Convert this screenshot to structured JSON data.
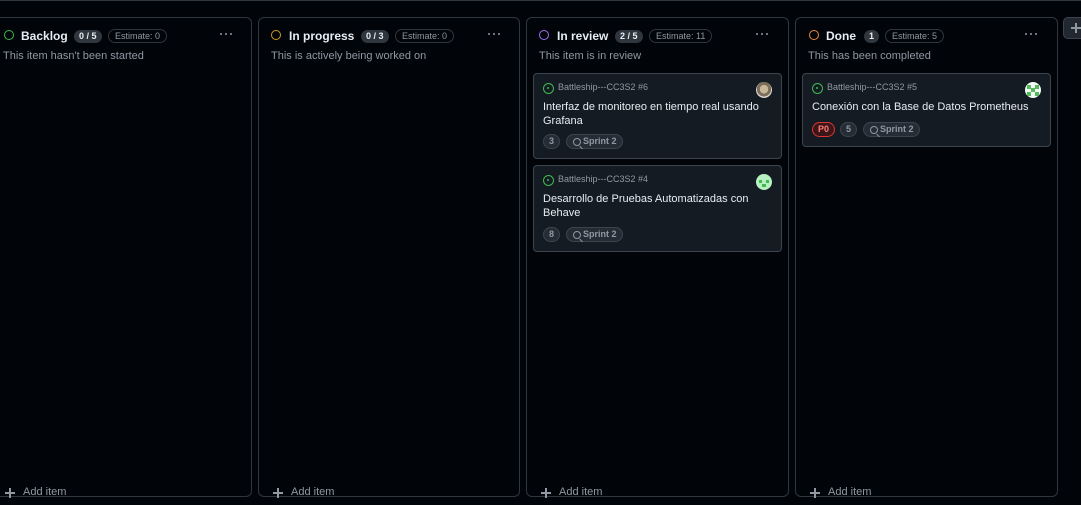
{
  "board": {
    "columns": [
      {
        "name": "Backlog",
        "count": "0 / 5",
        "estimate": "Estimate: 0",
        "description": "This item hasn't been started",
        "add_label": "Add item",
        "color": "#3fb950"
      },
      {
        "name": "In progress",
        "count": "0 / 3",
        "estimate": "Estimate: 0",
        "description": "This is actively being worked on",
        "add_label": "Add item",
        "color": "#d29922"
      },
      {
        "name": "In review",
        "count": "2 / 5",
        "estimate": "Estimate: 11",
        "description": "This item is in review",
        "add_label": "Add item",
        "color": "#a371f7"
      },
      {
        "name": "Done",
        "count": "1",
        "estimate": "Estimate: 5",
        "description": "This has been completed",
        "add_label": "Add item",
        "color": "#f0883e"
      }
    ],
    "cards": {
      "review_1": {
        "ref": "Battleship---CC3S2 #6",
        "title": "Interfaz de monitoreo en tiempo real usando Grafana",
        "estimate": "3",
        "sprint": "Sprint 2",
        "avatar_icon": "avatar-photo"
      },
      "review_2": {
        "ref": "Battleship---CC3S2 #4",
        "title": "Desarrollo de Pruebas Automatizadas con Behave",
        "estimate": "8",
        "sprint": "Sprint 2",
        "avatar_icon": "avatar-identicon-green"
      },
      "done_1": {
        "ref": "Battleship---CC3S2 #5",
        "title": "Conexión con la Base de Datos Prometheus",
        "priority": "P0",
        "estimate": "5",
        "sprint": "Sprint 2",
        "avatar_icon": "avatar-identicon-green"
      }
    }
  },
  "colors": {
    "background": "#010409",
    "card": "#151b23",
    "border": "#30363d",
    "text": "#e6edf3",
    "muted": "#9198a1",
    "issue_open": "#3fb950",
    "priority_p0": "#f85149"
  }
}
